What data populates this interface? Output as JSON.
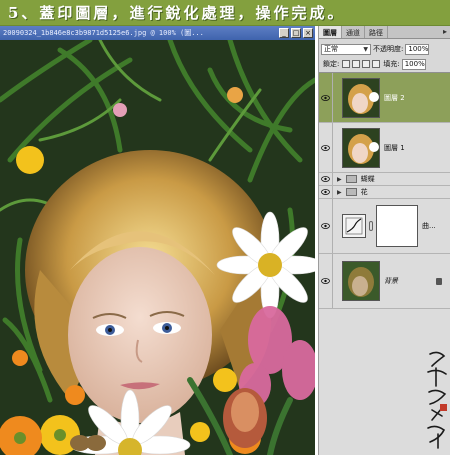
{
  "banner": {
    "text": "5、蓋印圖層，進行銳化處理，操作完成。"
  },
  "document": {
    "title": "20090324_1b846e8c3b9871d5125e6.jpg @ 100% (圖...",
    "controls": [
      "_",
      "□",
      "×"
    ]
  },
  "panel": {
    "tabs": [
      "圖層",
      "通道",
      "路徑"
    ],
    "blend_mode": "正常",
    "opacity_label": "不透明度:",
    "opacity_value": "100%",
    "lock_label": "鎖定:",
    "fill_label": "填充:",
    "fill_value": "100%",
    "layers": [
      {
        "name": "圖層 2",
        "type": "pixel",
        "selected": true
      },
      {
        "name": "圖層 1",
        "type": "pixel",
        "selected": false
      },
      {
        "name": "蝴蝶",
        "type": "group",
        "selected": false
      },
      {
        "name": "花",
        "type": "group",
        "selected": false
      },
      {
        "name": "曲...",
        "type": "adjustment",
        "selected": false
      },
      {
        "name": "背景",
        "type": "background",
        "selected": false
      }
    ]
  },
  "colors": {
    "banner": "#83a03e",
    "selected_layer": "#8da05a",
    "title_bar": "#3f63ad"
  },
  "icons": [
    "eye-icon",
    "folder-icon",
    "curves-icon",
    "lock-icon",
    "chain-icon"
  ]
}
